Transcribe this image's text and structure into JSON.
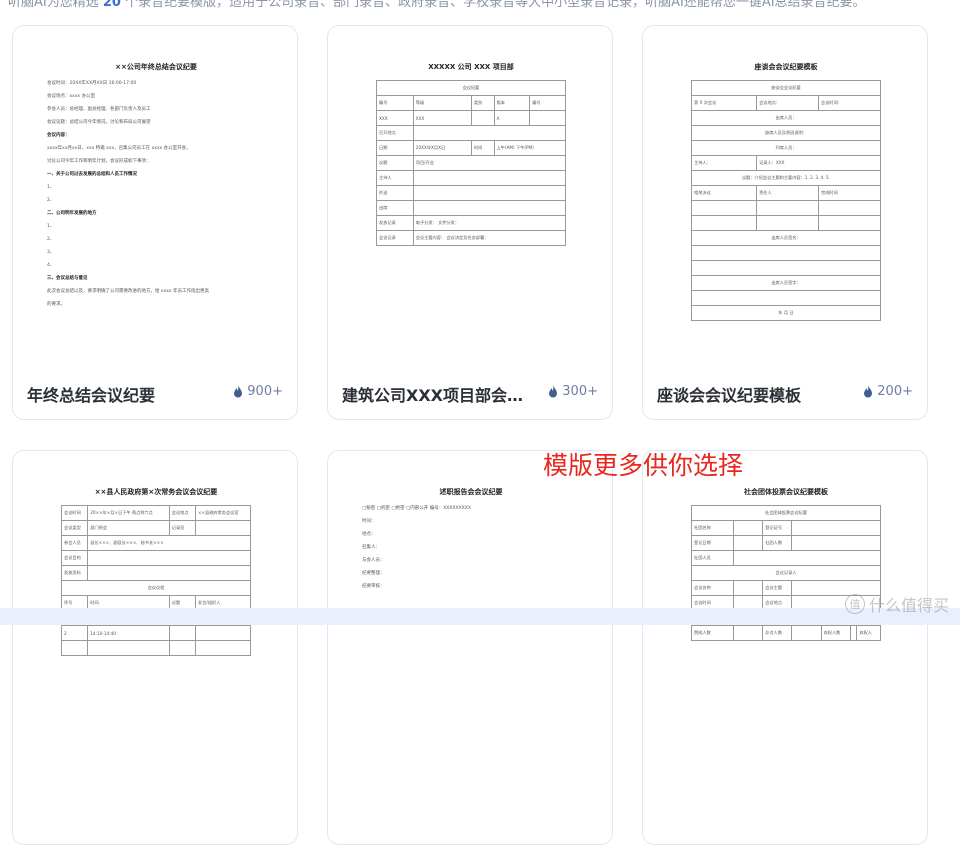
{
  "intro": {
    "before": "听脑AI为您精选 ",
    "count": "20",
    "after": " 个录音纪要模版，适用于公司录音、部门录音、政府录音、学校录音等大中小型录音记录，听脑AI还能帮您一键AI总结录音纪要。"
  },
  "promo": "模版更多供你选择",
  "watermark": {
    "logo": "值",
    "text": "什么值得买"
  },
  "colors": {
    "accent": "#3b6fd8",
    "promo": "#e8281e",
    "heat": "#6d7fa1",
    "card_border": "#dde8f6"
  },
  "cards": [
    {
      "title": "年终总结会议纪要",
      "heat": "900+",
      "icon": "flame-icon",
      "doc": {
        "title": "××公司年终总结会议纪要",
        "lines": [
          {
            "t": "会议时间：20XX年XX月XX日 16:00-17:00",
            "b": false
          },
          {
            "t": "会议地点：xxxx 办公室",
            "b": false
          },
          {
            "t": "参会人员：总经理、副总经理、各部门负责人及员工",
            "b": false
          },
          {
            "t": "会议议题：总结公司今年情况，讨论和布局公司展望",
            "b": false
          },
          {
            "t": "会议内容：",
            "b": true
          },
          {
            "t": "    xxxx年xx月xx日，xxx 特邀 xxx，召集公司员工在 xxxx 办公室开会，",
            "b": false
          },
          {
            "t": "讨论公司今年工作和明年计划，会议形成如下事项：",
            "b": false
          },
          {
            "t": "一、关于公司过去发展的总结和人员工作情况",
            "b": true
          },
          {
            "t": "    1、",
            "b": false
          },
          {
            "t": "    2、",
            "b": false
          },
          {
            "t": "二、公司明年发展的地方",
            "b": true
          },
          {
            "t": "    1、",
            "b": false
          },
          {
            "t": "    2、",
            "b": false
          },
          {
            "t": "    3、",
            "b": false
          },
          {
            "t": "    4、",
            "b": false
          },
          {
            "t": "三、会议总结与意见",
            "b": true
          },
          {
            "t": "    此次会议总结以及，要求明确了公司需要改进的地方，给 xxxx 年员工作指出更高",
            "b": false
          },
          {
            "t": "的要求。",
            "b": false
          }
        ]
      }
    },
    {
      "title": "建筑公司XXX项目部会议纪要",
      "heat": "300+",
      "icon": "flame-icon",
      "doc": {
        "title": "XXXXX 公司 XXX 项目部",
        "rows": [
          [
            "会议纪要"
          ],
          [
            "编号",
            "等级",
            "类别",
            "版本",
            "编号"
          ],
          [
            "XXX",
            "XXX",
            "",
            "A",
            ""
          ],
          [
            "召开地点",
            ""
          ],
          [
            "日期",
            "20XX年X月X日",
            "时间",
            "上午(AM) 下午(PM)"
          ],
          [
            "议题",
            "项目/开会"
          ],
          [
            "主持人",
            ""
          ],
          [
            "抄送",
            ""
          ],
          [
            "出席",
            ""
          ],
          [
            "发放记录",
            "电子分发： 文件分发："
          ],
          [
            "会议记录",
            "会议主要内容：  会议决定及任务部署："
          ]
        ]
      }
    },
    {
      "title": "座谈会会议纪要模板",
      "heat": "200+",
      "icon": "flame-icon",
      "doc": {
        "title": "座谈会会议纪要模板",
        "rows": [
          [
            "座谈会会议纪要"
          ],
          [
            "第 X 次会议",
            "会议地点：",
            "会议时间："
          ],
          [
            "出席人员："
          ],
          [
            "缺席人员及原因说明："
          ],
          [
            "列席人员："
          ],
          [
            "主持人：",
            "记录人：XXX"
          ],
          [
            "议题：介绍会议主题和主要内容：1. 2. 3. 4. 5."
          ],
          [
            "相关决议",
            "责任人",
            "完成时间"
          ],
          [
            "",
            "",
            " "
          ],
          [
            "",
            "",
            " "
          ],
          [
            "出席人员签名："
          ],
          [
            ""
          ],
          [
            ""
          ],
          [
            "出席人员签字："
          ],
          [
            ""
          ],
          [
            "年 月 日"
          ]
        ]
      }
    },
    {
      "title": "",
      "heat": "",
      "icon": "",
      "doc": {
        "title": "××县人民政府第×次常务会议会议纪要",
        "rows": [
          [
            "会议时间",
            "20××年×月×日下午 两点到六点",
            "会议地点",
            "××县政府常务会议室"
          ],
          [
            "会议类型",
            "部门例会",
            "记录员",
            ""
          ],
          [
            "参会人员",
            "县长×××、副县长×××、秘书长×××"
          ],
          [
            "会议目的",
            ""
          ],
          [
            "发放资料",
            ""
          ],
          [
            "会议议程"
          ],
          [
            "序号",
            "时间",
            "议题",
            "发言/组织人"
          ],
          [
            "1",
            "14:00-14:10",
            "",
            ""
          ],
          [
            "2",
            "14:10-14:40",
            "",
            ""
          ],
          [
            "",
            "",
            "",
            ""
          ]
        ]
      }
    },
    {
      "title": "",
      "heat": "",
      "icon": "",
      "doc": {
        "title": "述职报告会会议纪要",
        "lines": [
          {
            "t": "□秘密  □机密  □绝密  □内部公开  编号：XXXXXXXXX",
            "b": false
          },
          {
            "t": "时间：",
            "b": false
          },
          {
            "t": "地点：",
            "b": false
          },
          {
            "t": "召集人：",
            "b": false
          },
          {
            "t": "与会人员：",
            "b": false
          },
          {
            "t": "纪要整理：",
            "b": false
          },
          {
            "t": "纪要审核：",
            "b": false
          }
        ]
      }
    },
    {
      "title": "",
      "heat": "",
      "icon": "",
      "doc": {
        "title": "社会团体投票会议纪要模板",
        "rows": [
          [
            "社会团体投票会议纪要"
          ],
          [
            "社团名称",
            "",
            "登记证号",
            ""
          ],
          [
            "登记日期",
            "",
            "社团人数",
            ""
          ],
          [
            "社团人员",
            ""
          ],
          [
            "会议记录人"
          ],
          [
            "会议名称",
            "",
            "会议主题",
            ""
          ],
          [
            "会议时间",
            "",
            "会议地点",
            ""
          ],
          [
            "参会人员 范围",
            "应到人员",
            "",
            "实到人员",
            "",
            "列席人员"
          ],
          [
            "赞成人数",
            "",
            "反对人数",
            "",
            "弃权人数",
            "",
            "弃权人"
          ]
        ]
      }
    }
  ]
}
